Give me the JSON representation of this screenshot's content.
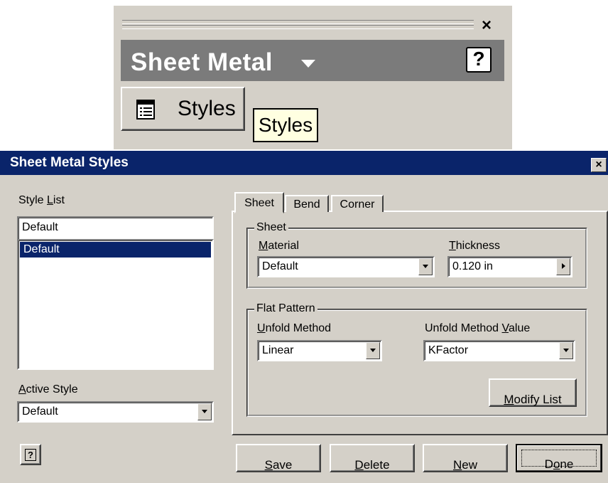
{
  "panel": {
    "close_glyph": "×",
    "title": "Sheet Metal",
    "title_icon": "chevron-down-icon",
    "help_glyph": "?",
    "styles_button_label": "Styles",
    "styles_button_icon": "styles-list-icon",
    "tooltip": "Styles"
  },
  "dialog": {
    "title": "Sheet Metal Styles",
    "close_glyph": "×",
    "style_list": {
      "label_before": "Style ",
      "label_underlined": "L",
      "label_after": "ist",
      "input_value": "Default",
      "items": [
        {
          "label": "Default",
          "selected": true
        }
      ]
    },
    "active_style": {
      "label_underlined": "A",
      "label_after": "ctive Style",
      "value": "Default"
    },
    "help_glyph": "?",
    "tabs": [
      {
        "label": "Sheet",
        "active": true
      },
      {
        "label": "Bend",
        "active": false
      },
      {
        "label": "Corner",
        "active": false
      }
    ],
    "sheet_group": {
      "title": "Sheet",
      "material": {
        "label_underlined": "M",
        "label_after": "aterial",
        "value": "Default"
      },
      "thickness": {
        "label_underlined": "T",
        "label_after": "hickness",
        "value": "0.120 in"
      }
    },
    "flat_pattern_group": {
      "title": "Flat Pattern",
      "unfold_method": {
        "label_underlined": "U",
        "label_after": "nfold Method",
        "value": "Linear"
      },
      "unfold_method_value": {
        "label_before": "Unfold Method ",
        "label_underlined": "V",
        "label_after": "alue",
        "value": "KFactor"
      },
      "modify_list": {
        "label_underlined": "M",
        "label_after": "odify List"
      }
    },
    "buttons": {
      "save": {
        "label_underlined": "S",
        "label_after": "ave"
      },
      "delete": {
        "label_underlined": "D",
        "label_after": "elete"
      },
      "new": {
        "label_underlined": "N",
        "label_after": "ew"
      },
      "done": {
        "label_before": "D",
        "label_underlined": "o",
        "label_after": "ne"
      }
    },
    "colors": {
      "titlebar": "#0a246a",
      "face": "#d4d0c8",
      "selection": "#0a246a"
    }
  }
}
